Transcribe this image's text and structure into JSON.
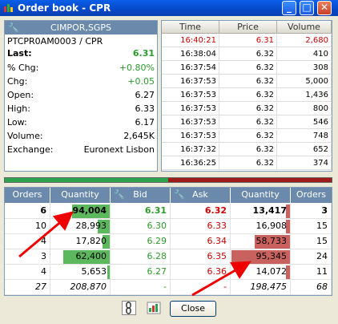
{
  "window": {
    "title": "Order book - CPR"
  },
  "info": {
    "company": "CIMPOR,SGPS",
    "isin": "PTCPR0AM0003 / CPR",
    "last": {
      "label": "Last:",
      "value": "6.31"
    },
    "rows": [
      {
        "label": "% Chg:",
        "value": "+0.80%",
        "color": "#2c9a2c"
      },
      {
        "label": "Chg:",
        "value": "+0.05",
        "color": "#2c9a2c"
      },
      {
        "label": "Open:",
        "value": "6.27",
        "color": "#000000"
      },
      {
        "label": "High:",
        "value": "6.33",
        "color": "#000000"
      },
      {
        "label": "Low:",
        "value": "6.17",
        "color": "#000000"
      },
      {
        "label": "Volume:",
        "value": "2,645K",
        "color": "#000000"
      },
      {
        "label": "Exchange:",
        "value": "Euronext Lisbon",
        "color": "#000000"
      }
    ]
  },
  "trades": {
    "headers": [
      "Time",
      "Price",
      "Volume"
    ],
    "rows": [
      [
        "16:40:21",
        "6.31",
        "2,680"
      ],
      [
        "16:38:04",
        "6.32",
        "410"
      ],
      [
        "16:37:54",
        "6.32",
        "308"
      ],
      [
        "16:37:53",
        "6.32",
        "5,000"
      ],
      [
        "16:37:53",
        "6.32",
        "1,436"
      ],
      [
        "16:37:53",
        "6.32",
        "800"
      ],
      [
        "16:37:53",
        "6.32",
        "546"
      ],
      [
        "16:37:53",
        "6.32",
        "748"
      ],
      [
        "16:37:32",
        "6.32",
        "652"
      ],
      [
        "16:36:25",
        "6.32",
        "374"
      ]
    ],
    "highlight_color": "#cc0000"
  },
  "balance": {
    "buy_fraction": 0.5
  },
  "book": {
    "headers": [
      "Orders",
      "Quantity",
      "Bid",
      "Ask",
      "Quantity",
      "Orders"
    ],
    "rows": [
      {
        "bo": "6",
        "bq": "94,004",
        "bid": "6.31",
        "ask": "6.32",
        "aq": "13,417",
        "ao": "3",
        "bfill": 0.65,
        "afill": 0.07
      },
      {
        "bo": "10",
        "bq": "28,993",
        "bid": "6.30",
        "ask": "6.33",
        "aq": "16,908",
        "ao": "15",
        "bfill": 0.2,
        "afill": 0.07
      },
      {
        "bo": "4",
        "bq": "17,820",
        "bid": "6.29",
        "ask": "6.34",
        "aq": "58,733",
        "ao": "15",
        "bfill": 0.12,
        "afill": 0.6
      },
      {
        "bo": "3",
        "bq": "62,400",
        "bid": "6.28",
        "ask": "6.35",
        "aq": "95,345",
        "ao": "24",
        "bfill": 0.8,
        "afill": 1.0
      },
      {
        "bo": "4",
        "bq": "5,653",
        "bid": "6.27",
        "ask": "6.36",
        "aq": "14,072",
        "ao": "11",
        "bfill": 0.04,
        "afill": 0.07
      }
    ],
    "totals": {
      "bo": "27",
      "bq": "208,870",
      "bid": "-",
      "ask": "-",
      "aq": "198,475",
      "ao": "68"
    }
  },
  "footer": {
    "close_label": "Close"
  },
  "colors": {
    "bid_bar": "#5cb85c",
    "ask_bar": "#c9625f",
    "bid_text": "#2c9a2c",
    "ask_text": "#cc0000",
    "header": "#6b8aab"
  }
}
